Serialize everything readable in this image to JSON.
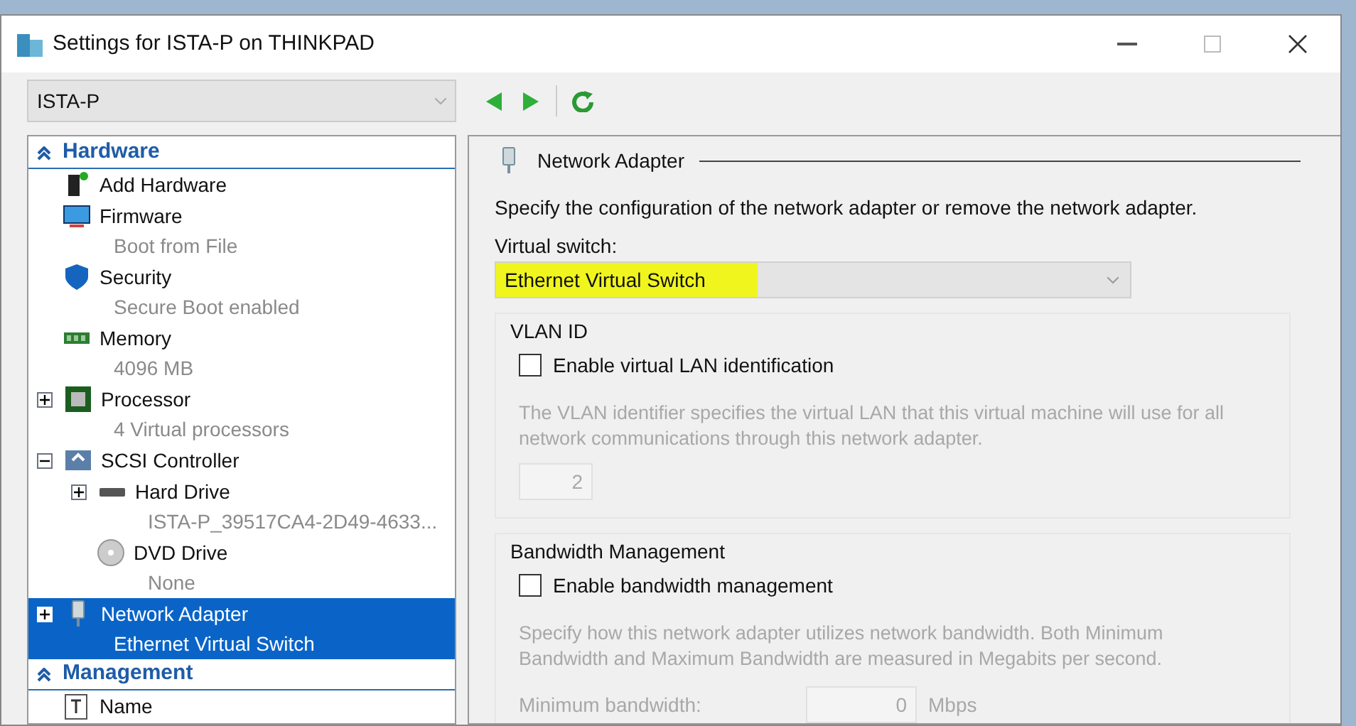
{
  "window": {
    "title": "Settings for ISTA-P on THINKPAD"
  },
  "vm_selector": {
    "value": "ISTA-P"
  },
  "tree": [
    {
      "label": "Hardware",
      "children": [
        {
          "kind": "add",
          "name": "Add Hardware",
          "selected": false
        },
        {
          "kind": "firmware",
          "name": "Firmware",
          "detail": "Boot from File",
          "selected": false
        },
        {
          "kind": "security",
          "name": "Security",
          "detail": "Secure Boot enabled",
          "selected": false
        },
        {
          "kind": "memory",
          "name": "Memory",
          "detail": "4096 MB",
          "selected": false
        },
        {
          "kind": "processor",
          "name": "Processor",
          "detail": "4 Virtual processors",
          "expanded": false,
          "selected": false
        },
        {
          "kind": "controller",
          "name": "SCSI Controller",
          "expanded": true,
          "selected": false,
          "children": [
            {
              "kind": "disk",
              "name": "Hard Drive",
              "detail": "ISTA-P_39517CA4-2D49-4633...",
              "expanded": false,
              "selected": false
            },
            {
              "kind": "dvd",
              "name": "DVD Drive",
              "detail": "None",
              "selected": false
            }
          ]
        },
        {
          "kind": "network",
          "name": "Network Adapter",
          "detail": "Ethernet Virtual Switch",
          "expanded": false,
          "selected": true
        }
      ]
    },
    {
      "label": "Management",
      "children": [
        {
          "kind": "name",
          "name": "Name",
          "selected": false
        }
      ]
    }
  ],
  "panel": {
    "title": "Network Adapter",
    "description": "Specify the configuration of the network adapter or remove the network adapter.",
    "switch_label": "Virtual switch:",
    "switch_value": "Ethernet Virtual Switch",
    "switch_highlighted": true,
    "vlan": {
      "title": "VLAN ID",
      "checkbox": {
        "label": "Enable virtual LAN identification",
        "checked": false
      },
      "description": "The VLAN identifier specifies the virtual LAN that this virtual machine will use for all network communications through this network adapter.",
      "value": "2",
      "disabled": true
    },
    "bandwidth": {
      "title": "Bandwidth Management",
      "checkbox": {
        "label": "Enable bandwidth management",
        "checked": false
      },
      "description": "Specify how this network adapter utilizes network bandwidth. Both Minimum Bandwidth and Maximum Bandwidth are measured in Megabits per second.",
      "min_label": "Minimum bandwidth:",
      "min_value": "0",
      "unit": "Mbps",
      "disabled": true
    }
  }
}
